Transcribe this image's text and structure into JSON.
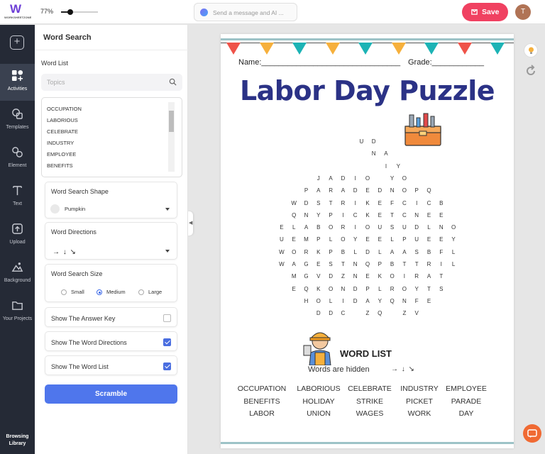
{
  "header": {
    "logo_text": "WORKSHEETZONE",
    "zoom_label": "77%",
    "zoom_fraction": 0.25,
    "ai_placeholder": "Send a message and AI ...",
    "save_label": "Save",
    "avatar_initial": "T"
  },
  "rail": {
    "items": [
      {
        "label": "Activities",
        "icon": "activities-icon"
      },
      {
        "label": "Templates",
        "icon": "templates-icon"
      },
      {
        "label": "Element",
        "icon": "element-icon"
      },
      {
        "label": "Text",
        "icon": "text-icon"
      },
      {
        "label": "Upload",
        "icon": "upload-icon"
      },
      {
        "label": "Background",
        "icon": "background-icon"
      },
      {
        "label": "Your Projects",
        "icon": "projects-icon"
      }
    ],
    "browse_line1": "Browsing",
    "browse_line2": "Library"
  },
  "panel": {
    "title": "Word Search",
    "word_list_label": "Word List",
    "topics_placeholder": "Topics",
    "words": [
      "OCCUPATION",
      "LABORIOUS",
      "CELEBRATE",
      "INDUSTRY",
      "EMPLOYEE",
      "BENEFITS"
    ],
    "shape_label": "Word Search Shape",
    "shape_value": "Pumpkin",
    "directions_label": "Word Directions",
    "directions_value": "→ ↓ ↘",
    "size_label": "Word Search Size",
    "size_options": [
      "Small",
      "Medium",
      "Large"
    ],
    "size_selected": "Medium",
    "toggles": [
      {
        "label": "Show The Answer Key",
        "checked": false
      },
      {
        "label": "Show The Word Directions",
        "checked": true
      },
      {
        "label": "Show The Word List",
        "checked": true
      }
    ],
    "scramble_label": "Scramble"
  },
  "worksheet": {
    "name_label": "Name:________________________________",
    "grade_label": "Grade:____________",
    "title": "Labor Day Puzzle",
    "grid_rows": [
      "U D",
      "N A",
      "I Y",
      "J A D I O Y O",
      "P A R A D E D N O P Q",
      "W D S T R I K E F C I C B",
      "Q N Y P I C K E T C N E E",
      "E L A B O R I O U S U D L N O",
      "U E M P L O Y E E L P U E E Y",
      "W O R K P B L D L A A S B F L",
      "W A G E S T N Q P B T T R I L",
      "M G V D Z N E K O I R A T",
      "E Q K O N D P L R O Y T S",
      "H O L I D A Y Q N F E",
      "D D C Z Q Z V"
    ],
    "word_list_title": "WORD LIST",
    "hidden_note": "Words are hidden",
    "hidden_arrows": "→ ↓ ↘",
    "word_list": [
      "OCCUPATION",
      "LABORIOUS",
      "CELEBRATE",
      "INDUSTRY",
      "EMPLOYEE",
      "BENEFITS",
      "HOLIDAY",
      "STRIKE",
      "PICKET",
      "PARADE",
      "LABOR",
      "UNION",
      "WAGES",
      "WORK",
      "DAY"
    ]
  },
  "colors": {
    "accent": "#4f76ec",
    "save": "#f04161",
    "rail_bg": "#252a36",
    "title": "#2b3286",
    "flags": [
      "#ef5349",
      "#f6b03c",
      "#1cb3b5"
    ]
  }
}
